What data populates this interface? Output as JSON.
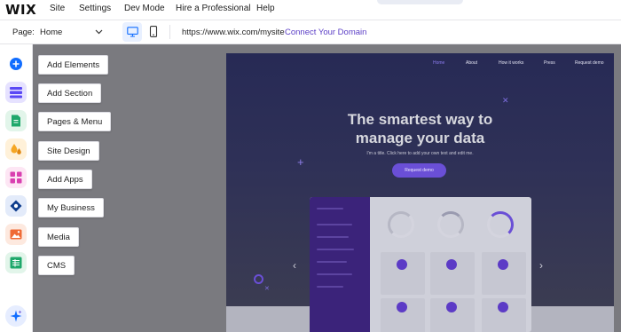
{
  "app": {
    "logo": "WIX"
  },
  "top_menu": {
    "items": [
      "Site",
      "Settings",
      "Dev Mode",
      "Hire a Professional",
      "Help"
    ]
  },
  "page_bar": {
    "page_label": "Page:",
    "page_value": "Home",
    "url": "https://www.wix.com/mysite",
    "connect_label": "Connect Your Domain"
  },
  "sidebar": {
    "items": [
      {
        "label": "Add Elements",
        "icon": "plus-icon",
        "color": "#116dff"
      },
      {
        "label": "Add Section",
        "icon": "section-icon",
        "color": "#5a48f5"
      },
      {
        "label": "Pages & Menu",
        "icon": "page-icon",
        "color": "#1ea86b"
      },
      {
        "label": "Site Design",
        "icon": "design-drops-icon",
        "color": "#f5a623"
      },
      {
        "label": "Add Apps",
        "icon": "apps-grid-icon",
        "color": "#d93fb0"
      },
      {
        "label": "My Business",
        "icon": "business-icon",
        "color": "#0d3c8c"
      },
      {
        "label": "Media",
        "icon": "image-icon",
        "color": "#ef6a35"
      },
      {
        "label": "CMS",
        "icon": "table-icon",
        "color": "#1ea86b"
      }
    ],
    "ai_icon": "sparkle-icon"
  },
  "site_preview": {
    "nav": [
      "Home",
      "About",
      "How it works",
      "Press",
      "Request demo"
    ],
    "headline_line1": "The smartest way to",
    "headline_line2": "manage your data",
    "subline": "I'm a title. Click here to add your own text and edit me.",
    "cta": "Request demo",
    "accent": "#6a4fd6"
  }
}
